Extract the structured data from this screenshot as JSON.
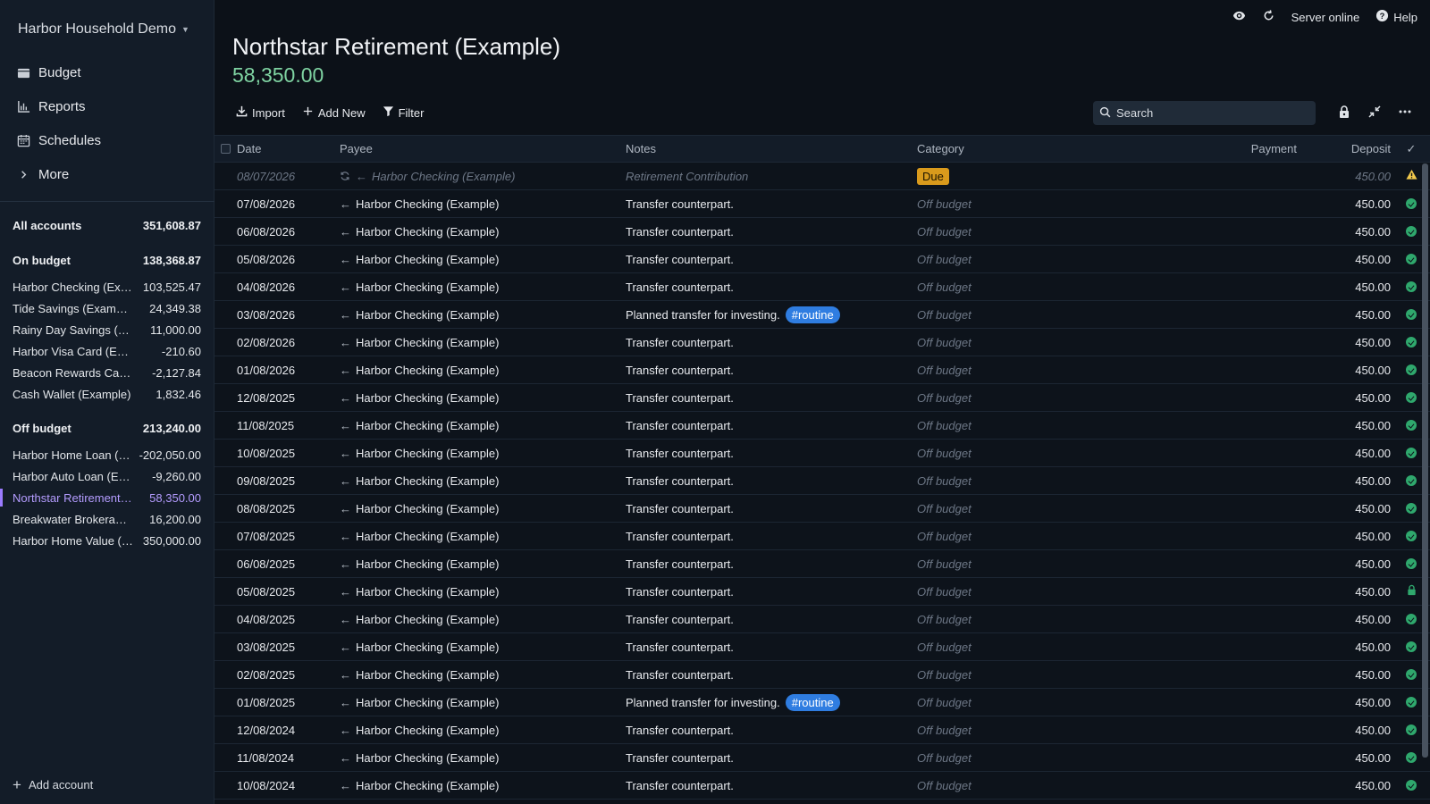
{
  "budget_name": "Harbor Household Demo",
  "nav": [
    {
      "label": "Budget",
      "icon": "wallet-icon"
    },
    {
      "label": "Reports",
      "icon": "bar-chart-icon"
    },
    {
      "label": "Schedules",
      "icon": "calendar-icon"
    },
    {
      "label": "More",
      "icon": "chevron-right-icon"
    }
  ],
  "accounts": {
    "all": {
      "label": "All accounts",
      "balance": "351,608.87"
    },
    "on_budget": {
      "label": "On budget",
      "balance": "138,368.87"
    },
    "on_budget_items": [
      {
        "name": "Harbor Checking (Example)",
        "balance": "103,525.47"
      },
      {
        "name": "Tide Savings (Example)",
        "balance": "24,349.38"
      },
      {
        "name": "Rainy Day Savings (Example)",
        "balance": "11,000.00"
      },
      {
        "name": "Harbor Visa Card (Example)",
        "balance": "-210.60"
      },
      {
        "name": "Beacon Rewards Card (Example)",
        "balance": "-2,127.84"
      },
      {
        "name": "Cash Wallet (Example)",
        "balance": "1,832.46"
      }
    ],
    "off_budget": {
      "label": "Off budget",
      "balance": "213,240.00"
    },
    "off_budget_items": [
      {
        "name": "Harbor Home Loan (Example)",
        "balance": "-202,050.00"
      },
      {
        "name": "Harbor Auto Loan (Example)",
        "balance": "-9,260.00"
      },
      {
        "name": "Northstar Retirement (Example)",
        "balance": "58,350.00",
        "active": true
      },
      {
        "name": "Breakwater Brokerage (Example)",
        "balance": "16,200.00"
      },
      {
        "name": "Harbor Home Value (Example)",
        "balance": "350,000.00"
      }
    ],
    "add_label": "Add account"
  },
  "topbar": {
    "server_status": "Server online",
    "help": "Help"
  },
  "account": {
    "title": "Northstar Retirement (Example)",
    "balance": "58,350.00"
  },
  "toolbar": {
    "import": "Import",
    "add_new": "Add New",
    "filter": "Filter",
    "search_placeholder": "Search"
  },
  "columns": {
    "date": "Date",
    "payee": "Payee",
    "notes": "Notes",
    "category": "Category",
    "payment": "Payment",
    "deposit": "Deposit",
    "cleared": "✓"
  },
  "transactions": [
    {
      "date": "08/07/2026",
      "payee": "Harbor Checking (Example)",
      "notes": "Retirement Contribution",
      "category": "Due",
      "payment": "",
      "deposit": "450.00",
      "status": "warning",
      "scheduled": true
    },
    {
      "date": "07/08/2026",
      "payee": "Harbor Checking (Example)",
      "notes": "Transfer counterpart.",
      "category": "Off budget",
      "payment": "",
      "deposit": "450.00",
      "status": "cleared"
    },
    {
      "date": "06/08/2026",
      "payee": "Harbor Checking (Example)",
      "notes": "Transfer counterpart.",
      "category": "Off budget",
      "payment": "",
      "deposit": "450.00",
      "status": "cleared"
    },
    {
      "date": "05/08/2026",
      "payee": "Harbor Checking (Example)",
      "notes": "Transfer counterpart.",
      "category": "Off budget",
      "payment": "",
      "deposit": "450.00",
      "status": "cleared"
    },
    {
      "date": "04/08/2026",
      "payee": "Harbor Checking (Example)",
      "notes": "Transfer counterpart.",
      "category": "Off budget",
      "payment": "",
      "deposit": "450.00",
      "status": "cleared"
    },
    {
      "date": "03/08/2026",
      "payee": "Harbor Checking (Example)",
      "notes": "Planned transfer for investing.",
      "tag": "#routine",
      "category": "Off budget",
      "payment": "",
      "deposit": "450.00",
      "status": "cleared"
    },
    {
      "date": "02/08/2026",
      "payee": "Harbor Checking (Example)",
      "notes": "Transfer counterpart.",
      "category": "Off budget",
      "payment": "",
      "deposit": "450.00",
      "status": "cleared"
    },
    {
      "date": "01/08/2026",
      "payee": "Harbor Checking (Example)",
      "notes": "Transfer counterpart.",
      "category": "Off budget",
      "payment": "",
      "deposit": "450.00",
      "status": "cleared"
    },
    {
      "date": "12/08/2025",
      "payee": "Harbor Checking (Example)",
      "notes": "Transfer counterpart.",
      "category": "Off budget",
      "payment": "",
      "deposit": "450.00",
      "status": "cleared"
    },
    {
      "date": "11/08/2025",
      "payee": "Harbor Checking (Example)",
      "notes": "Transfer counterpart.",
      "category": "Off budget",
      "payment": "",
      "deposit": "450.00",
      "status": "cleared"
    },
    {
      "date": "10/08/2025",
      "payee": "Harbor Checking (Example)",
      "notes": "Transfer counterpart.",
      "category": "Off budget",
      "payment": "",
      "deposit": "450.00",
      "status": "cleared"
    },
    {
      "date": "09/08/2025",
      "payee": "Harbor Checking (Example)",
      "notes": "Transfer counterpart.",
      "category": "Off budget",
      "payment": "",
      "deposit": "450.00",
      "status": "cleared"
    },
    {
      "date": "08/08/2025",
      "payee": "Harbor Checking (Example)",
      "notes": "Transfer counterpart.",
      "category": "Off budget",
      "payment": "",
      "deposit": "450.00",
      "status": "cleared"
    },
    {
      "date": "07/08/2025",
      "payee": "Harbor Checking (Example)",
      "notes": "Transfer counterpart.",
      "category": "Off budget",
      "payment": "",
      "deposit": "450.00",
      "status": "cleared"
    },
    {
      "date": "06/08/2025",
      "payee": "Harbor Checking (Example)",
      "notes": "Transfer counterpart.",
      "category": "Off budget",
      "payment": "",
      "deposit": "450.00",
      "status": "cleared"
    },
    {
      "date": "05/08/2025",
      "payee": "Harbor Checking (Example)",
      "notes": "Transfer counterpart.",
      "category": "Off budget",
      "payment": "",
      "deposit": "450.00",
      "status": "locked"
    },
    {
      "date": "04/08/2025",
      "payee": "Harbor Checking (Example)",
      "notes": "Transfer counterpart.",
      "category": "Off budget",
      "payment": "",
      "deposit": "450.00",
      "status": "cleared"
    },
    {
      "date": "03/08/2025",
      "payee": "Harbor Checking (Example)",
      "notes": "Transfer counterpart.",
      "category": "Off budget",
      "payment": "",
      "deposit": "450.00",
      "status": "cleared"
    },
    {
      "date": "02/08/2025",
      "payee": "Harbor Checking (Example)",
      "notes": "Transfer counterpart.",
      "category": "Off budget",
      "payment": "",
      "deposit": "450.00",
      "status": "cleared"
    },
    {
      "date": "01/08/2025",
      "payee": "Harbor Checking (Example)",
      "notes": "Planned transfer for investing.",
      "tag": "#routine",
      "category": "Off budget",
      "payment": "",
      "deposit": "450.00",
      "status": "cleared"
    },
    {
      "date": "12/08/2024",
      "payee": "Harbor Checking (Example)",
      "notes": "Transfer counterpart.",
      "category": "Off budget",
      "payment": "",
      "deposit": "450.00",
      "status": "cleared"
    },
    {
      "date": "11/08/2024",
      "payee": "Harbor Checking (Example)",
      "notes": "Transfer counterpart.",
      "category": "Off budget",
      "payment": "",
      "deposit": "450.00",
      "status": "cleared"
    },
    {
      "date": "10/08/2024",
      "payee": "Harbor Checking (Example)",
      "notes": "Transfer counterpart.",
      "category": "Off budget",
      "payment": "",
      "deposit": "450.00",
      "status": "cleared"
    }
  ],
  "colors": {
    "accent": "#9b7bff",
    "balance_positive": "#7fd3a2",
    "cleared": "#2fa86d",
    "tag": "#2f7de1",
    "due": "#d99a1c"
  }
}
